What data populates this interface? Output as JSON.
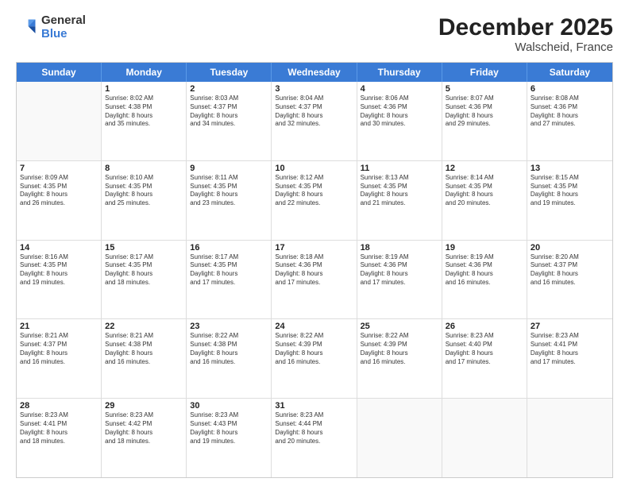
{
  "logo": {
    "line1": "General",
    "line2": "Blue"
  },
  "title": "December 2025",
  "subtitle": "Walscheid, France",
  "days": [
    "Sunday",
    "Monday",
    "Tuesday",
    "Wednesday",
    "Thursday",
    "Friday",
    "Saturday"
  ],
  "rows": [
    [
      {
        "day": "",
        "info": ""
      },
      {
        "day": "1",
        "info": "Sunrise: 8:02 AM\nSunset: 4:38 PM\nDaylight: 8 hours\nand 35 minutes."
      },
      {
        "day": "2",
        "info": "Sunrise: 8:03 AM\nSunset: 4:37 PM\nDaylight: 8 hours\nand 34 minutes."
      },
      {
        "day": "3",
        "info": "Sunrise: 8:04 AM\nSunset: 4:37 PM\nDaylight: 8 hours\nand 32 minutes."
      },
      {
        "day": "4",
        "info": "Sunrise: 8:06 AM\nSunset: 4:36 PM\nDaylight: 8 hours\nand 30 minutes."
      },
      {
        "day": "5",
        "info": "Sunrise: 8:07 AM\nSunset: 4:36 PM\nDaylight: 8 hours\nand 29 minutes."
      },
      {
        "day": "6",
        "info": "Sunrise: 8:08 AM\nSunset: 4:36 PM\nDaylight: 8 hours\nand 27 minutes."
      }
    ],
    [
      {
        "day": "7",
        "info": "Sunrise: 8:09 AM\nSunset: 4:35 PM\nDaylight: 8 hours\nand 26 minutes."
      },
      {
        "day": "8",
        "info": "Sunrise: 8:10 AM\nSunset: 4:35 PM\nDaylight: 8 hours\nand 25 minutes."
      },
      {
        "day": "9",
        "info": "Sunrise: 8:11 AM\nSunset: 4:35 PM\nDaylight: 8 hours\nand 23 minutes."
      },
      {
        "day": "10",
        "info": "Sunrise: 8:12 AM\nSunset: 4:35 PM\nDaylight: 8 hours\nand 22 minutes."
      },
      {
        "day": "11",
        "info": "Sunrise: 8:13 AM\nSunset: 4:35 PM\nDaylight: 8 hours\nand 21 minutes."
      },
      {
        "day": "12",
        "info": "Sunrise: 8:14 AM\nSunset: 4:35 PM\nDaylight: 8 hours\nand 20 minutes."
      },
      {
        "day": "13",
        "info": "Sunrise: 8:15 AM\nSunset: 4:35 PM\nDaylight: 8 hours\nand 19 minutes."
      }
    ],
    [
      {
        "day": "14",
        "info": "Sunrise: 8:16 AM\nSunset: 4:35 PM\nDaylight: 8 hours\nand 19 minutes."
      },
      {
        "day": "15",
        "info": "Sunrise: 8:17 AM\nSunset: 4:35 PM\nDaylight: 8 hours\nand 18 minutes."
      },
      {
        "day": "16",
        "info": "Sunrise: 8:17 AM\nSunset: 4:35 PM\nDaylight: 8 hours\nand 17 minutes."
      },
      {
        "day": "17",
        "info": "Sunrise: 8:18 AM\nSunset: 4:36 PM\nDaylight: 8 hours\nand 17 minutes."
      },
      {
        "day": "18",
        "info": "Sunrise: 8:19 AM\nSunset: 4:36 PM\nDaylight: 8 hours\nand 17 minutes."
      },
      {
        "day": "19",
        "info": "Sunrise: 8:19 AM\nSunset: 4:36 PM\nDaylight: 8 hours\nand 16 minutes."
      },
      {
        "day": "20",
        "info": "Sunrise: 8:20 AM\nSunset: 4:37 PM\nDaylight: 8 hours\nand 16 minutes."
      }
    ],
    [
      {
        "day": "21",
        "info": "Sunrise: 8:21 AM\nSunset: 4:37 PM\nDaylight: 8 hours\nand 16 minutes."
      },
      {
        "day": "22",
        "info": "Sunrise: 8:21 AM\nSunset: 4:38 PM\nDaylight: 8 hours\nand 16 minutes."
      },
      {
        "day": "23",
        "info": "Sunrise: 8:22 AM\nSunset: 4:38 PM\nDaylight: 8 hours\nand 16 minutes."
      },
      {
        "day": "24",
        "info": "Sunrise: 8:22 AM\nSunset: 4:39 PM\nDaylight: 8 hours\nand 16 minutes."
      },
      {
        "day": "25",
        "info": "Sunrise: 8:22 AM\nSunset: 4:39 PM\nDaylight: 8 hours\nand 16 minutes."
      },
      {
        "day": "26",
        "info": "Sunrise: 8:23 AM\nSunset: 4:40 PM\nDaylight: 8 hours\nand 17 minutes."
      },
      {
        "day": "27",
        "info": "Sunrise: 8:23 AM\nSunset: 4:41 PM\nDaylight: 8 hours\nand 17 minutes."
      }
    ],
    [
      {
        "day": "28",
        "info": "Sunrise: 8:23 AM\nSunset: 4:41 PM\nDaylight: 8 hours\nand 18 minutes."
      },
      {
        "day": "29",
        "info": "Sunrise: 8:23 AM\nSunset: 4:42 PM\nDaylight: 8 hours\nand 18 minutes."
      },
      {
        "day": "30",
        "info": "Sunrise: 8:23 AM\nSunset: 4:43 PM\nDaylight: 8 hours\nand 19 minutes."
      },
      {
        "day": "31",
        "info": "Sunrise: 8:23 AM\nSunset: 4:44 PM\nDaylight: 8 hours\nand 20 minutes."
      },
      {
        "day": "",
        "info": ""
      },
      {
        "day": "",
        "info": ""
      },
      {
        "day": "",
        "info": ""
      }
    ]
  ]
}
